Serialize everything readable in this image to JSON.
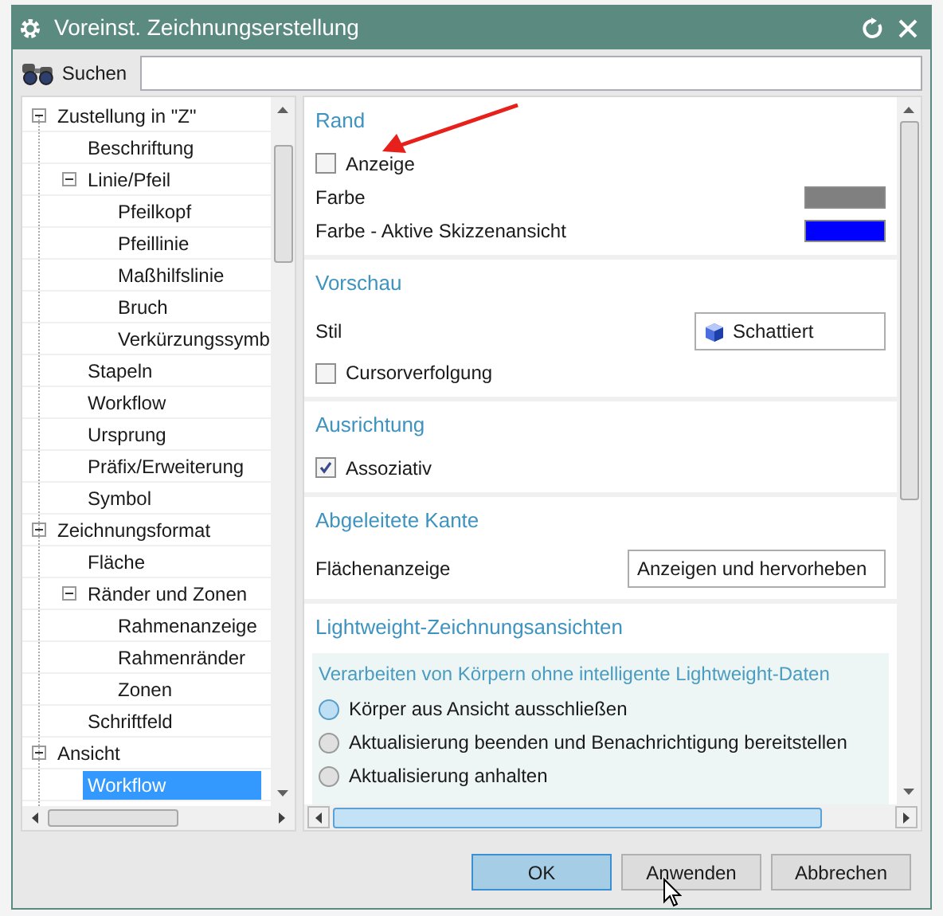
{
  "window": {
    "title": "Voreinst. Zeichnungserstellung"
  },
  "search": {
    "label": "Suchen"
  },
  "tree": [
    {
      "label": "Zustellung in \"Z\"",
      "expanded": true,
      "selected": false,
      "children": [
        {
          "label": "Beschriftung",
          "selected": false
        },
        {
          "label": "Linie/Pfeil",
          "expanded": true,
          "selected": false,
          "children": [
            {
              "label": "Pfeilkopf",
              "selected": false
            },
            {
              "label": "Pfeillinie",
              "selected": false
            },
            {
              "label": "Maßhilfslinie",
              "selected": false
            },
            {
              "label": "Bruch",
              "selected": false
            },
            {
              "label": "Verkürzungssymb",
              "selected": false
            }
          ]
        },
        {
          "label": "Stapeln",
          "selected": false
        },
        {
          "label": "Workflow",
          "selected": false
        },
        {
          "label": "Ursprung",
          "selected": false
        },
        {
          "label": "Präfix/Erweiterung",
          "selected": false
        },
        {
          "label": "Symbol",
          "selected": false
        }
      ]
    },
    {
      "label": "Zeichnungsformat",
      "expanded": true,
      "selected": false,
      "children": [
        {
          "label": "Fläche",
          "selected": false
        },
        {
          "label": "Ränder und Zonen",
          "expanded": true,
          "selected": false,
          "children": [
            {
              "label": "Rahmenanzeige",
              "selected": false
            },
            {
              "label": "Rahmenränder",
              "selected": false
            },
            {
              "label": "Zonen",
              "selected": false
            }
          ]
        },
        {
          "label": "Schriftfeld",
          "selected": false
        }
      ]
    },
    {
      "label": "Ansicht",
      "expanded": true,
      "selected": false,
      "children": [
        {
          "label": "Workflow",
          "selected": true
        }
      ]
    }
  ],
  "sections": [
    {
      "title": "Rand",
      "items": [
        {
          "kind": "checkbox",
          "label": "Anzeige",
          "checked": false
        },
        {
          "kind": "color",
          "label": "Farbe",
          "color": "#808080"
        },
        {
          "kind": "color",
          "label": "Farbe - Aktive Skizzenansicht",
          "color": "#0000ff"
        }
      ]
    },
    {
      "title": "Vorschau",
      "items": [
        {
          "kind": "dropdown",
          "label": "Stil",
          "value": "Schattiert",
          "icon": true
        },
        {
          "kind": "checkbox",
          "label": "Cursorverfolgung",
          "checked": false
        }
      ]
    },
    {
      "title": "Ausrichtung",
      "items": [
        {
          "kind": "checkbox",
          "label": "Assoziativ",
          "checked": true
        }
      ]
    },
    {
      "title": "Abgeleitete Kante",
      "items": [
        {
          "kind": "dropdown",
          "label": "Flächenanzeige",
          "value": "Anzeigen und hervorheben",
          "icon": false
        }
      ]
    },
    {
      "title": "Lightweight-Zeichnungsansichten",
      "items": [
        {
          "kind": "radio-group",
          "label": "Verarbeiten von Körpern ohne intelligente Lightweight-Daten",
          "options": [
            {
              "label": "Körper aus Ansicht ausschließen",
              "selected": true
            },
            {
              "label": "Aktualisierung beenden und Benachrichtigung bereitstellen",
              "selected": false
            },
            {
              "label": "Aktualisierung anhalten",
              "selected": false
            }
          ]
        }
      ]
    }
  ],
  "buttons": [
    {
      "label": "OK",
      "default": true
    },
    {
      "label": "Anwenden",
      "default": false
    },
    {
      "label": "Abbrechen",
      "default": false
    }
  ]
}
